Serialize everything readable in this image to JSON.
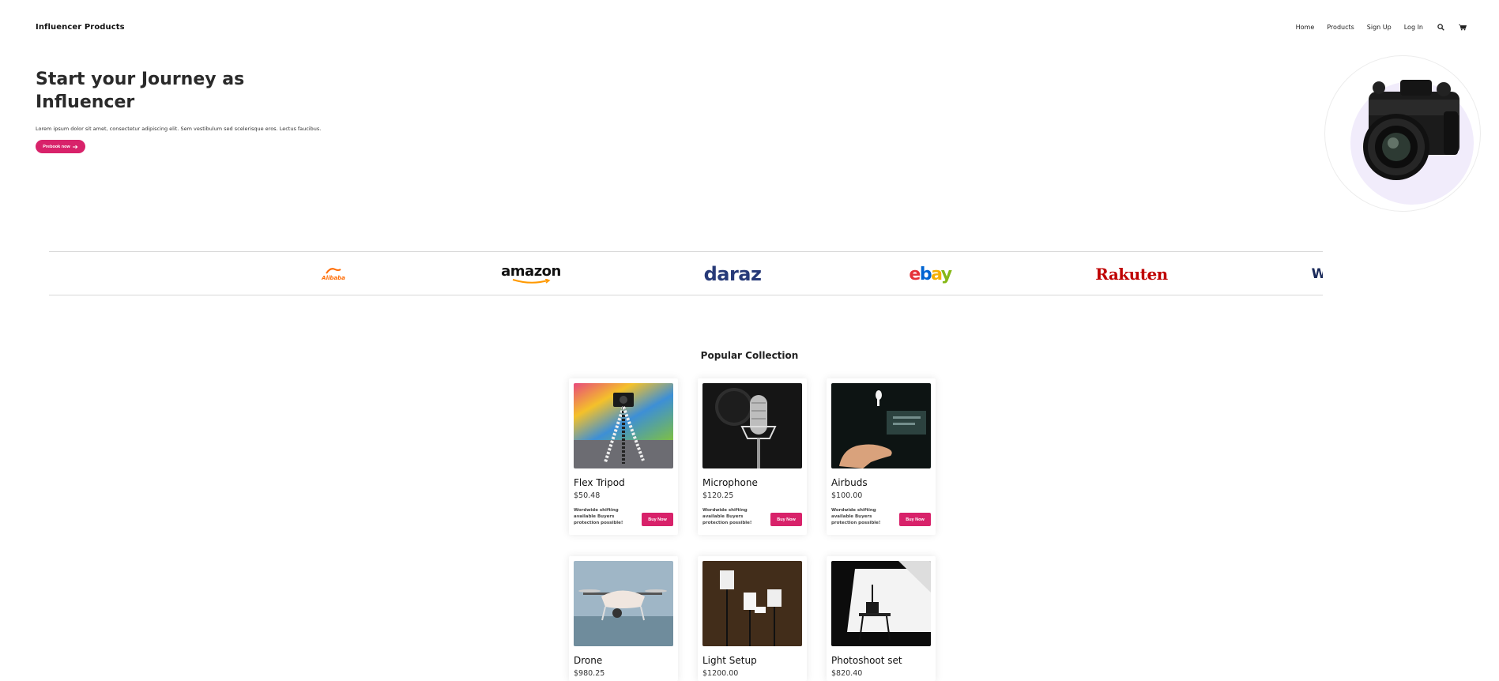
{
  "header": {
    "brand": "Influencer Products",
    "nav": [
      "Home",
      "Products",
      "Sign Up",
      "Log In"
    ],
    "icons": [
      "search-icon",
      "cart-icon"
    ]
  },
  "hero": {
    "title": "Start your Journey as Influencer",
    "text": "Lorem ipsum dolor sit amet, consectetur adipiscing elit. Sem vestibulum sed scelerisque eros. Lectus faucibus.",
    "cta_label": "Prebook now",
    "image": "camera"
  },
  "brands": [
    "Alibaba",
    "amazon",
    "daraz",
    "ebay",
    "Rakuten",
    "W"
  ],
  "colors": {
    "accent": "#d8226a",
    "alibaba": "#ff6a00",
    "amazon": "#111111",
    "rakuten": "#bf0000"
  },
  "collection": {
    "title": "Popular Collection",
    "desc": "Wordwide shifting available Buyers protection possible!",
    "buy_label": "Buy Now",
    "products": [
      {
        "name": "Flex Tripod",
        "price": "$50.48"
      },
      {
        "name": "Microphone",
        "price": "$120.25"
      },
      {
        "name": "Airbuds",
        "price": "$100.00"
      },
      {
        "name": "Drone",
        "price": "$980.25"
      },
      {
        "name": "Light Setup",
        "price": "$1200.00"
      },
      {
        "name": "Photoshoot set",
        "price": "$820.40"
      }
    ]
  }
}
